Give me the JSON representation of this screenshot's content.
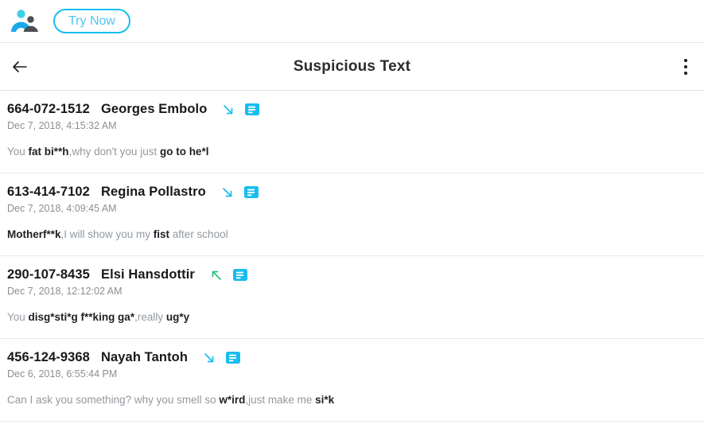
{
  "promo": {
    "logo_icon": "two-people-logo-icon",
    "try_now_label": "Try Now"
  },
  "header": {
    "back_icon": "back-arrow-icon",
    "title": "Suspicious Text",
    "menu_icon": "kebab-menu-icon"
  },
  "colors": {
    "accent_cyan": "#18bdf0",
    "outgoing_green": "#2bbf7a",
    "title_dark": "#2b2b2b",
    "body_gray": "#9299a0",
    "flag_dark": "#1d2023",
    "separator": "#e8e8e8"
  },
  "messages": [
    {
      "phone": "664-072-1512",
      "name": "Georges Embolo",
      "direction": "incoming",
      "direction_icon": "arrow-down-right-icon",
      "sms_icon": "sms-message-icon",
      "timestamp": "Dec 7, 2018, 4:15:32 AM",
      "segments": [
        {
          "text": "You ",
          "flagged": false
        },
        {
          "text": "fat bi**h",
          "flagged": true
        },
        {
          "text": ",why don't you just ",
          "flagged": false
        },
        {
          "text": "go to he*l",
          "flagged": true
        }
      ]
    },
    {
      "phone": "613-414-7102",
      "name": "Regina Pollastro",
      "direction": "incoming",
      "direction_icon": "arrow-down-right-icon",
      "sms_icon": "sms-message-icon",
      "timestamp": "Dec 7, 2018, 4:09:45 AM",
      "segments": [
        {
          "text": "Motherf**k",
          "flagged": true
        },
        {
          "text": ",I will show you my ",
          "flagged": false
        },
        {
          "text": "fist",
          "flagged": true
        },
        {
          "text": " after school",
          "flagged": false
        }
      ]
    },
    {
      "phone": "290-107-8435",
      "name": "Elsi Hansdottir",
      "direction": "outgoing",
      "direction_icon": "arrow-up-left-icon",
      "sms_icon": "sms-message-icon",
      "timestamp": "Dec 7, 2018, 12:12:02 AM",
      "segments": [
        {
          "text": "You ",
          "flagged": false
        },
        {
          "text": "disg*sti*g f**king ga*",
          "flagged": true
        },
        {
          "text": ",really ",
          "flagged": false
        },
        {
          "text": "ug*y",
          "flagged": true
        }
      ]
    },
    {
      "phone": "456-124-9368",
      "name": "Nayah Tantoh",
      "direction": "incoming",
      "direction_icon": "arrow-down-right-icon",
      "sms_icon": "sms-message-icon",
      "timestamp": "Dec 6, 2018, 6:55:44 PM",
      "segments": [
        {
          "text": "Can I ask you something? why you smell so ",
          "flagged": false
        },
        {
          "text": "w*ird",
          "flagged": true
        },
        {
          "text": ",just make me ",
          "flagged": false
        },
        {
          "text": "si*k",
          "flagged": true
        }
      ]
    }
  ]
}
